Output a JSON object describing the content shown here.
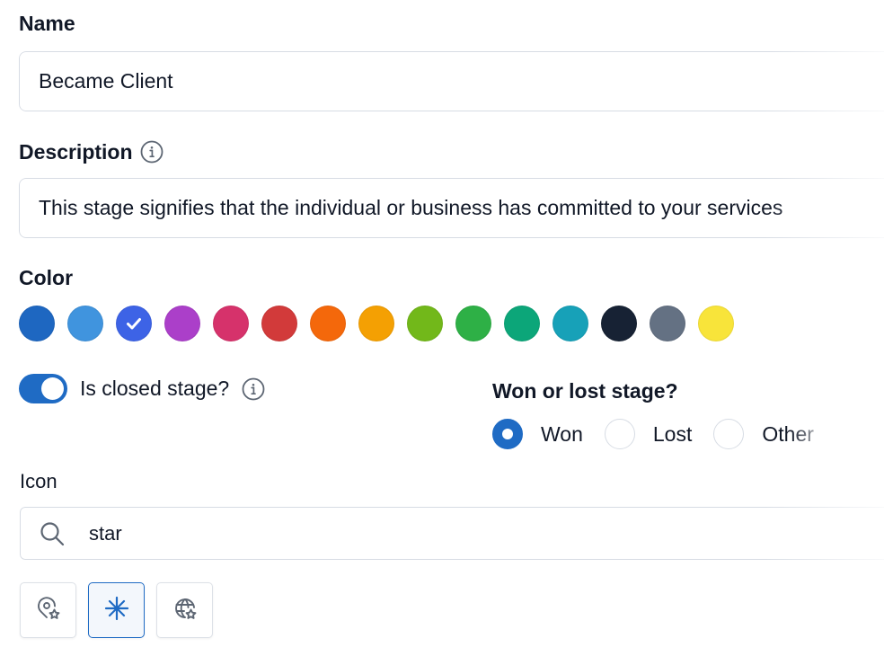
{
  "name": {
    "label": "Name",
    "value": "Became Client"
  },
  "description": {
    "label": "Description",
    "info_icon": "info-circle-icon",
    "value": "This stage signifies that the individual or business has committed to your services"
  },
  "color": {
    "label": "Color",
    "selected_index": 2,
    "swatches": [
      {
        "name": "dark-blue",
        "hex": "#1e67c1"
      },
      {
        "name": "light-blue",
        "hex": "#4094de"
      },
      {
        "name": "indigo",
        "hex": "#3d63e6"
      },
      {
        "name": "purple",
        "hex": "#ab3fc9"
      },
      {
        "name": "pink",
        "hex": "#d6326b"
      },
      {
        "name": "red",
        "hex": "#d23a3a"
      },
      {
        "name": "orange",
        "hex": "#f4680b"
      },
      {
        "name": "amber",
        "hex": "#f4a003"
      },
      {
        "name": "lime",
        "hex": "#72b81a"
      },
      {
        "name": "green",
        "hex": "#2eb046"
      },
      {
        "name": "emerald",
        "hex": "#0ca679"
      },
      {
        "name": "cyan",
        "hex": "#17a1b8"
      },
      {
        "name": "navy",
        "hex": "#172234"
      },
      {
        "name": "slate",
        "hex": "#647183"
      },
      {
        "name": "yellow",
        "hex": "#f8e43a"
      }
    ]
  },
  "closed_stage": {
    "label": "Is closed stage?",
    "checked": true,
    "info_icon": "info-circle-icon"
  },
  "won_lost": {
    "title": "Won or lost stage?",
    "selected": "Won",
    "options": [
      "Won",
      "Lost",
      "Other"
    ]
  },
  "icon": {
    "label": "Icon",
    "search_value": "star",
    "search_icon": "search-icon",
    "results": [
      {
        "name": "location-star-icon",
        "selected": false
      },
      {
        "name": "asterisk-icon",
        "selected": true
      },
      {
        "name": "globe-star-icon",
        "selected": false
      }
    ]
  },
  "colors": {
    "accent": "#1f6bc4",
    "border": "#d7dce4",
    "icon_gray": "#5d6673"
  }
}
